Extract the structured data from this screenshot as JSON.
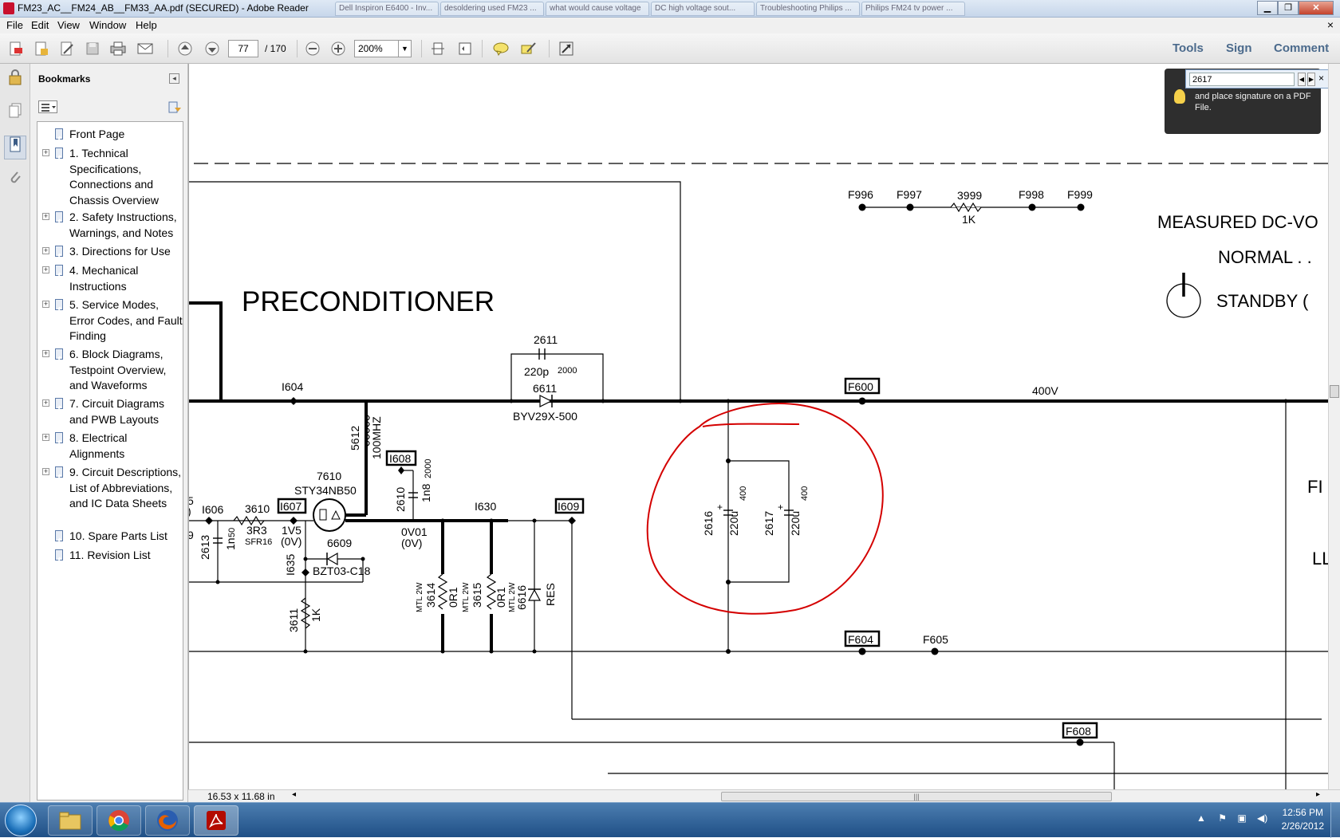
{
  "window": {
    "title": "FM23_AC__FM24_AB__FM33_AA.pdf (SECURED) - Adobe Reader",
    "ghost_tabs": [
      "Dell Inspiron E6400 - Inv...",
      "desoldering used FM23 ...",
      "what would cause voltage",
      "DC high voltage sout...",
      "Troubleshooting Philips ...",
      "Philips FM24 tv power ..."
    ]
  },
  "menu": {
    "items": [
      "File",
      "Edit",
      "View",
      "Window",
      "Help"
    ],
    "close": "×"
  },
  "toolbar": {
    "page_current": "77",
    "page_total": "/ 170",
    "zoom": "200%",
    "tools": "Tools",
    "sign": "Sign",
    "comment": "Comment"
  },
  "bookmarks": {
    "title": "Bookmarks",
    "items": [
      {
        "label": "Front Page",
        "expandable": false
      },
      {
        "label": "1. Technical Specifications, Connections and Chassis Overview",
        "expandable": true
      },
      {
        "label": "2. Safety Instructions, Warnings, and Notes",
        "expandable": true
      },
      {
        "label": "3. Directions for Use",
        "expandable": true
      },
      {
        "label": "4. Mechanical Instructions",
        "expandable": true
      },
      {
        "label": "5. Service Modes, Error Codes, and Fault Finding",
        "expandable": true
      },
      {
        "label": "6. Block Diagrams, Testpoint Overview, and Waveforms",
        "expandable": true
      },
      {
        "label": "7. Circuit Diagrams and PWB Layouts",
        "expandable": true
      },
      {
        "label": "8. Electrical Alignments",
        "expandable": true
      },
      {
        "label": "9. Circuit Descriptions, List of Abbreviations, and IC Data Sheets",
        "expandable": true
      },
      {
        "label": "10. Spare Parts List",
        "expandable": false
      },
      {
        "label": "11. Revision List",
        "expandable": false
      }
    ]
  },
  "find": {
    "value": "2617"
  },
  "tip": {
    "text": "and place signature on a PDF File."
  },
  "status": {
    "page_size": "16.53 x 11.68 in"
  },
  "schematic": {
    "title": "PRECONDITIONER",
    "measured": "MEASURED DC-VO",
    "normal": "NORMAL . .",
    "standby": "STANDBY (",
    "fi": "FI",
    "ll": "LL",
    "labels": {
      "f996": "F996",
      "f997": "F997",
      "r3999": "3999",
      "r3999v": "1K",
      "f998": "F998",
      "f999": "F999",
      "i604": "I604",
      "c2611": "2611",
      "c2611v": "220p",
      "c2611r": "2000",
      "d6611": "6611",
      "d6611p": "BYV29X-500",
      "f600": "F600",
      "v400": "400V",
      "l5612": "5612",
      "l5612v": "100MHZ",
      "i608": "I608",
      "c2610": "2610",
      "c2610v": "1n8",
      "c2610r": "2000",
      "q7610": "7610",
      "q7610p": "STY34NB50",
      "i606": "I606",
      "r3610": "3610",
      "r3610v": "3R3",
      "r3610p": "SFR16",
      "i607": "I607",
      "v1v5": "1V5",
      "v0v": "(0V)",
      "c2613": "2613",
      "c2613v": "1n",
      "c2613r": "50",
      "d6609": "6609",
      "d6609p": "BZT03-C18",
      "i635": "I635",
      "r3611": "3611",
      "r3611v": "1K",
      "v0v01": "0V01",
      "v0v01b": "(0V)",
      "i630": "I630",
      "i609": "I609",
      "r3614": "3614",
      "r3614v": "0R1",
      "r3614p": "MTL 2W",
      "r3615": "3615",
      "r3615v": "0R1",
      "r3615p": "MTL 2W",
      "d6616": "6616",
      "d6616v": "RES",
      "c2616": "2616",
      "c2616v": "220u",
      "c2616r": "400",
      "c2617": "2617",
      "c2617v": "220u",
      "c2617r": "400",
      "f604": "F604",
      "f605": "F605",
      "f608": "F608",
      "edge5": "5",
      "edgeparen": ")",
      "edge9": "9"
    }
  },
  "taskbar": {
    "time": "12:56 PM",
    "date": "2/26/2012"
  },
  "colors": {
    "annotation": "#d40000",
    "accent": "#4b6a8c"
  }
}
